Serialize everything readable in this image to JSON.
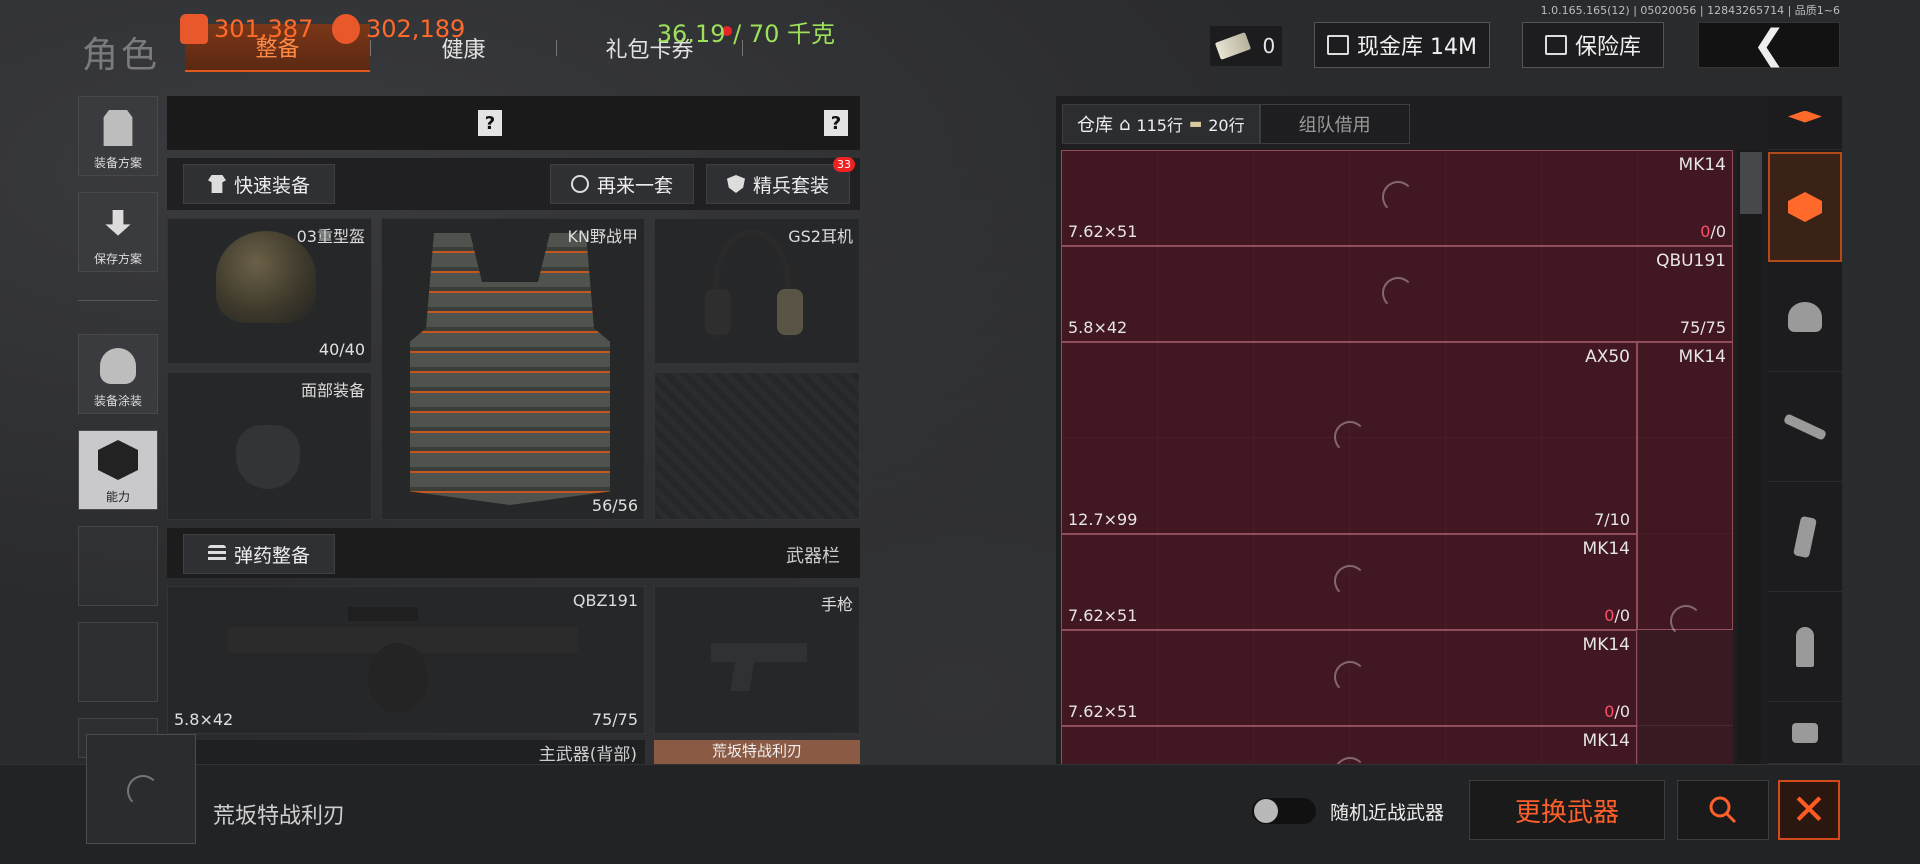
{
  "version_text": "1.0.165.165(12) | 05020056 | 12843265714 | 品质1~6",
  "header": {
    "title": "角色",
    "tabs": [
      {
        "label": "整备",
        "active": true
      },
      {
        "label": "健康",
        "active": false
      },
      {
        "label": "礼包卡券",
        "active": false,
        "has_notification": true
      }
    ],
    "cash_count": "0",
    "cash_vault_label": "现金库 14M",
    "insurance_label": "保险库",
    "back_icon": "back-arrow-icon"
  },
  "sidebar": {
    "items": [
      {
        "label": "装备方案",
        "icon": "vest-icon"
      },
      {
        "label": "保存方案",
        "icon": "download-icon"
      },
      {
        "label": "装备涂装",
        "icon": "paint-icon"
      },
      {
        "label": "能力",
        "icon": "ability-icon",
        "active": true
      }
    ]
  },
  "stats": {
    "value1": "301,387",
    "value2": "302,189",
    "weight": "36.19 / 70 千克",
    "help": "?"
  },
  "actions": {
    "quick_equip": "快速装备",
    "another_set": "再来一套",
    "elite_set": "精兵套装",
    "elite_badge": "33"
  },
  "slots": {
    "helmet": {
      "name": "03重型盔",
      "durability": "40/40"
    },
    "armor": {
      "name": "KN野战甲",
      "durability": "56/56"
    },
    "headset": {
      "name": "GS2耳机"
    },
    "face": {
      "name": "面部装备"
    },
    "weapon_header_left": "弹药整备",
    "weapon_header_right": "武器栏",
    "primary": {
      "name": "QBZ191",
      "caliber": "5.8×42",
      "ammo": "75/75",
      "footer": "主武器(背部)"
    },
    "pistol": {
      "name": "手枪",
      "footer": "荒坂特战利刃"
    }
  },
  "warehouse": {
    "tab_label": "仓库",
    "rows_label": "115行",
    "ammo_rows_label": "20行",
    "team_borrow": "组队借用",
    "items": [
      {
        "name": "MK14",
        "caliber": "7.62×51",
        "qty_zero": "0",
        "qty_rest": "/0"
      },
      {
        "name": "QBU191",
        "caliber": "5.8×42",
        "qty_zero": "",
        "qty_rest": "75/75"
      },
      {
        "name": "AX50",
        "caliber": "12.7×99",
        "qty_zero": "",
        "qty_rest": "7/10"
      },
      {
        "name": "MK14",
        "caliber": "",
        "qty_zero": "",
        "qty_rest": ""
      },
      {
        "name": "MK14",
        "caliber": "7.62×51",
        "qty_zero": "0",
        "qty_rest": "/0"
      },
      {
        "name": "MK14",
        "caliber": "7.62×51",
        "qty_zero": "0",
        "qty_rest": "/0"
      },
      {
        "name": "MK14",
        "caliber": "",
        "qty_zero": "",
        "qty_rest": ""
      }
    ],
    "categories": [
      "layers-icon",
      "vest-icon",
      "rifle-icon",
      "magazine-icon",
      "bullet-icon",
      "bag-icon"
    ]
  },
  "bottom": {
    "selected_item": "荒坂特战利刃",
    "toggle_label": "随机近战武器",
    "swap_weapon": "更换武器"
  },
  "colors": {
    "accent": "#ff6a2b",
    "weight_green": "#9de05a",
    "warehouse_bg": "#3a1a22",
    "zero_qty": "#ff4f6d"
  }
}
